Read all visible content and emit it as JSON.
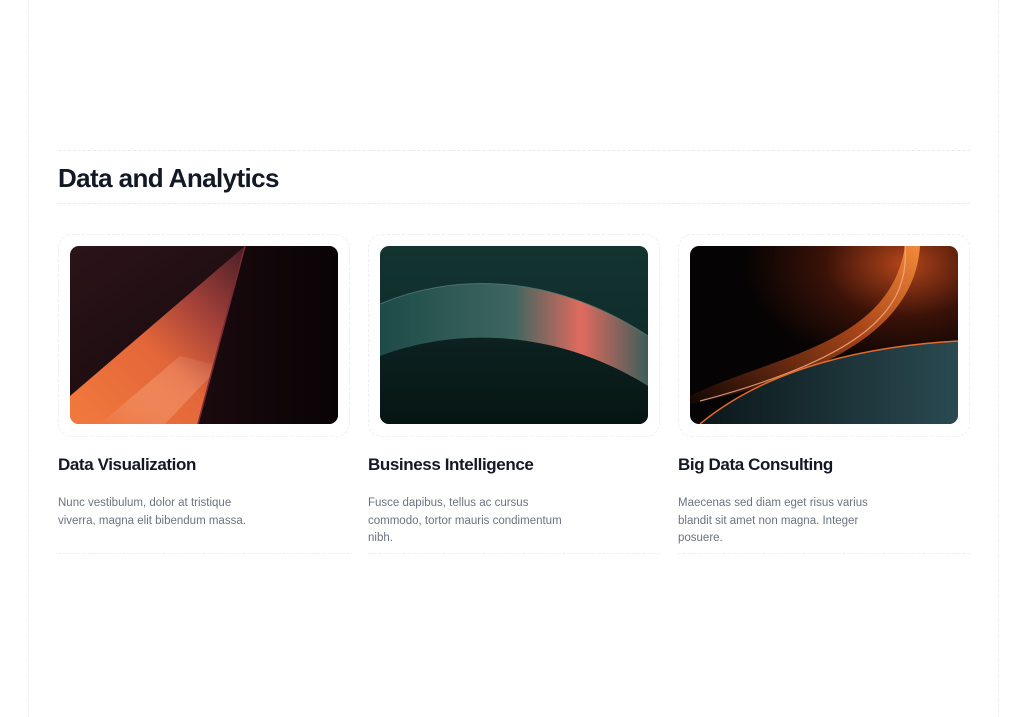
{
  "section": {
    "title": "Data and Analytics"
  },
  "cards": [
    {
      "title": "Data Visualization",
      "description": "Nunc vestibulum, dolor at tristique viverra, magna elit bibendum massa.",
      "image": "abstract-orange-triangle-image"
    },
    {
      "title": "Business Intelligence",
      "description": "Fusce dapibus, tellus ac cursus commodo, tortor mauris condimentum nibh.",
      "image": "abstract-teal-wave-image"
    },
    {
      "title": "Big Data Consulting",
      "description": "Maecenas sed diam eget risus varius blandit sit amet non magna. Integer posuere.",
      "image": "abstract-dark-curve-image"
    }
  ],
  "colors": {
    "heading": "#121826",
    "body_text": "#6b7280",
    "divider": "#e7e9ec",
    "accent_orange": "#f07038",
    "accent_teal": "#1f4a48"
  }
}
